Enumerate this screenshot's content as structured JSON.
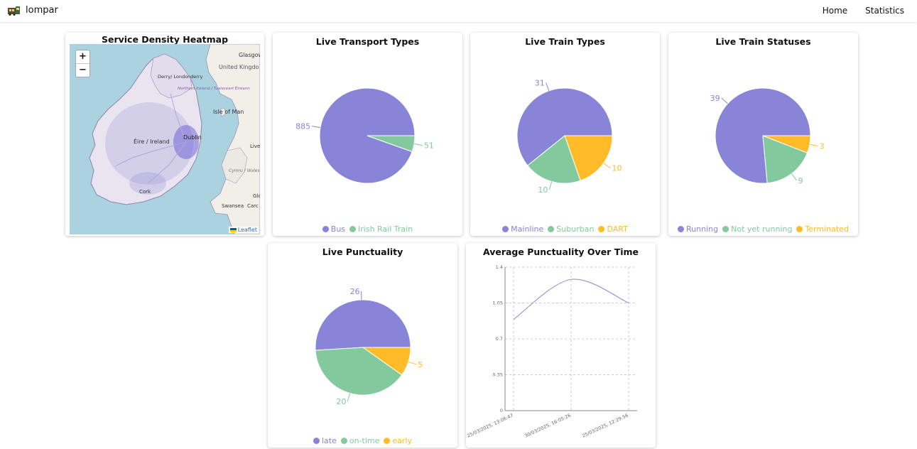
{
  "nav": {
    "brand": "lompar",
    "links": [
      "Home",
      "Statistics"
    ]
  },
  "colors": {
    "purple": "#8884d8",
    "green": "#82ca9d",
    "yellow": "#ffbb28"
  },
  "heatmap": {
    "title": "Service Density Heatmap",
    "zoom_in": "+",
    "zoom_out": "−",
    "attribution": "Leaflet",
    "place_labels": [
      "Glasgow",
      "United Kingdo",
      "Derry/ Londonderry",
      "Northern Ireland / Tuaisceart Éireann",
      "Isle of Man",
      "Éire / Ireland",
      "Dublin",
      "Live",
      "Cymru / Wales",
      "Cork",
      "Glo",
      "Swansea",
      "Carc"
    ]
  },
  "transport_types": {
    "title": "Live Transport Types",
    "chart_data": {
      "type": "pie",
      "categories": [
        "Bus",
        "Irish Rail Train"
      ],
      "values": [
        885,
        51
      ]
    }
  },
  "train_types": {
    "title": "Live Train Types",
    "chart_data": {
      "type": "pie",
      "categories": [
        "Mainline",
        "Suburban",
        "DART"
      ],
      "values": [
        31,
        10,
        10
      ]
    }
  },
  "train_statuses": {
    "title": "Live Train Statuses",
    "chart_data": {
      "type": "pie",
      "categories": [
        "Running",
        "Not yet running",
        "Terminated"
      ],
      "values": [
        39,
        9,
        3
      ]
    }
  },
  "punctuality": {
    "title": "Live Punctuality",
    "chart_data": {
      "type": "pie",
      "categories": [
        "late",
        "on-time",
        "early"
      ],
      "values": [
        26,
        20,
        5
      ]
    }
  },
  "punctuality_time": {
    "title": "Average Punctuality Over Time",
    "chart_data": {
      "type": "line",
      "x": [
        "25/03/2025, 13:06:47",
        "30/03/2025, 16:05:26",
        "25/03/2025, 12:29:56"
      ],
      "y": [
        0.89,
        1.28,
        1.05
      ],
      "ylim": [
        0,
        1.4
      ],
      "yticks": [
        "0",
        "0.35",
        "0.7",
        "1.05",
        "1.4"
      ],
      "grid": true
    }
  }
}
